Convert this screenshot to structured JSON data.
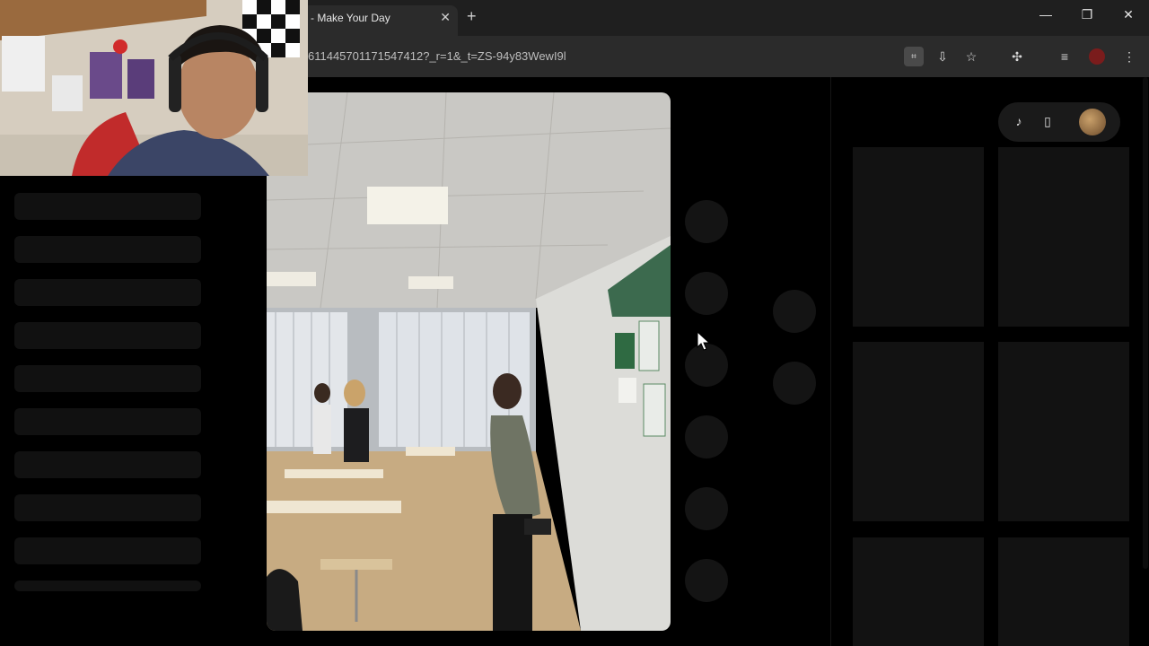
{
  "browser": {
    "tab_title": "- Make Your Day",
    "tab_close": "✕",
    "new_tab": "+",
    "url": "611445701171547412?_r=1&_t=ZS-94y83WewI9l",
    "window_controls": {
      "minimize": "—",
      "restore": "❐",
      "close": "✕"
    },
    "toolbar_icons": [
      "translate-icon",
      "install-icon",
      "bookmark-star-icon",
      "extensions-icon",
      "media-controls-icon",
      "profile-avatar",
      "menu-icon"
    ]
  },
  "page": {
    "left_skeleton_rows": 10,
    "video_side_dots": 6,
    "right_panel": {
      "pill_icons": [
        "tiktok-icon",
        "phone-icon",
        "user-avatar"
      ]
    }
  },
  "colors": {
    "background": "#000000",
    "chrome": "#1f1f1f",
    "toolbar": "#2b2b2b",
    "skeleton": "#111111"
  }
}
